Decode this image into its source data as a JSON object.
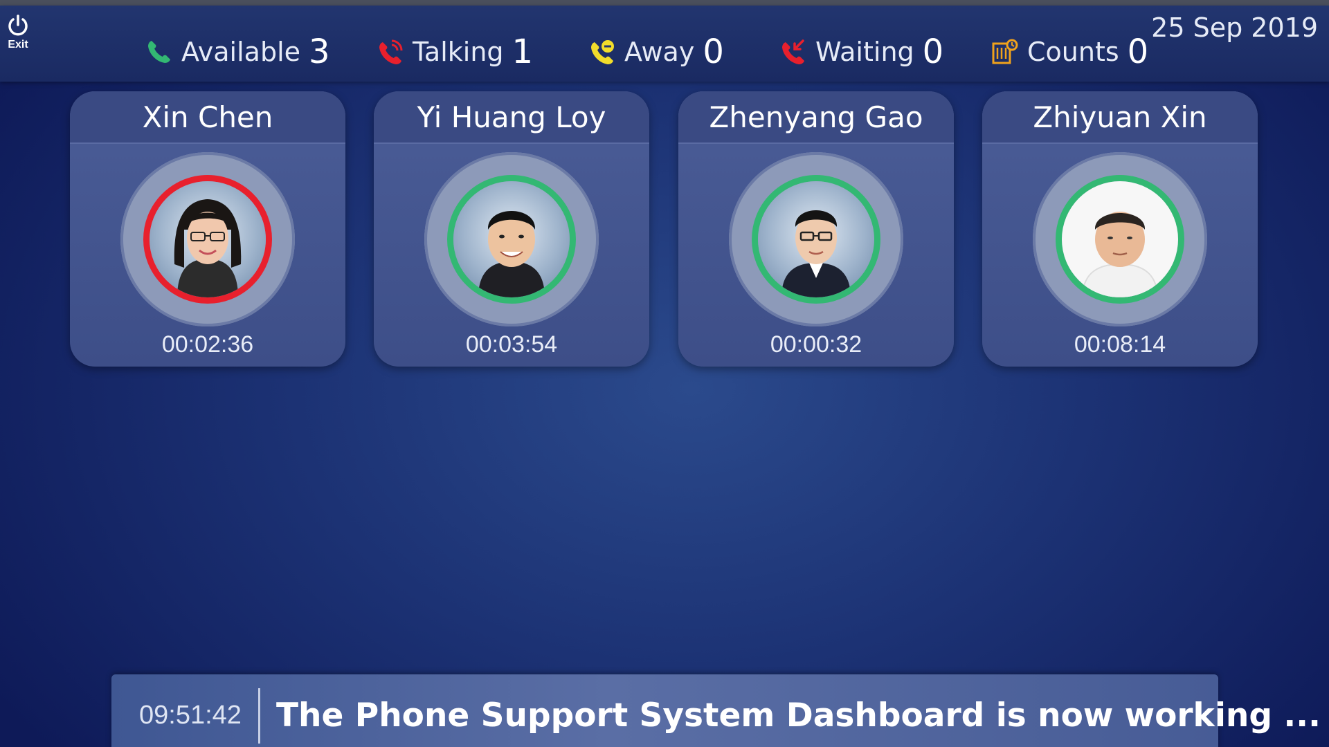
{
  "header": {
    "exit_label": "Exit",
    "date": "25 Sep 2019",
    "stats": [
      {
        "label": "Available",
        "count": "3",
        "icon": "phone-available-icon",
        "color": "#33b873"
      },
      {
        "label": "Talking",
        "count": "1",
        "icon": "phone-talking-icon",
        "color": "#e8202d"
      },
      {
        "label": "Away",
        "count": "0",
        "icon": "phone-away-icon",
        "color": "#f2dd2b"
      },
      {
        "label": "Waiting",
        "count": "0",
        "icon": "phone-waiting-icon",
        "color": "#e8202d"
      },
      {
        "label": "Counts",
        "count": "0",
        "icon": "call-counts-icon",
        "color": "#f0a21c"
      }
    ]
  },
  "agents": [
    {
      "name": "Xin Chen",
      "timer": "00:02:36",
      "status": "talking",
      "status_color": "#e8202d"
    },
    {
      "name": "Yi Huang Loy",
      "timer": "00:03:54",
      "status": "available",
      "status_color": "#33b873"
    },
    {
      "name": "Zhenyang Gao",
      "timer": "00:00:32",
      "status": "available",
      "status_color": "#33b873"
    },
    {
      "name": "Zhiyuan Xin",
      "timer": "00:08:14",
      "status": "available",
      "status_color": "#33b873"
    }
  ],
  "ticker": {
    "time": "09:51:42",
    "message": "The Phone Support System Dashboard is now working ..."
  }
}
